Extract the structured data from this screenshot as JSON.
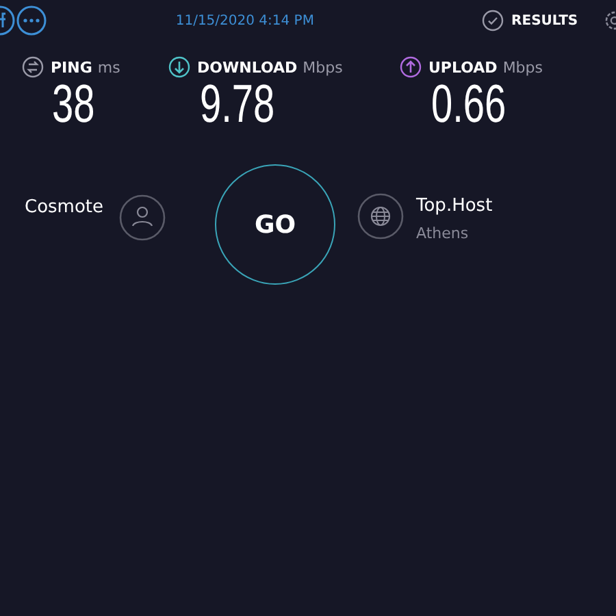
{
  "top_bar": {
    "date": "11/15/2020 4:14 PM",
    "results_label": "RESULTS"
  },
  "metrics": [
    {
      "kind": "ping",
      "label": "PING",
      "unit": "ms",
      "value": "38"
    },
    {
      "kind": "download",
      "label": "DOWNLOAD",
      "unit": "Mbps",
      "value": "9.78"
    },
    {
      "kind": "upload",
      "label": "UPLOAD",
      "unit": "Mbps",
      "value": "0.66"
    }
  ],
  "provider": {
    "name": "Cosmote"
  },
  "go_button": {
    "label": "GO"
  },
  "server": {
    "name": "Top.Host",
    "location": "Athens"
  }
}
